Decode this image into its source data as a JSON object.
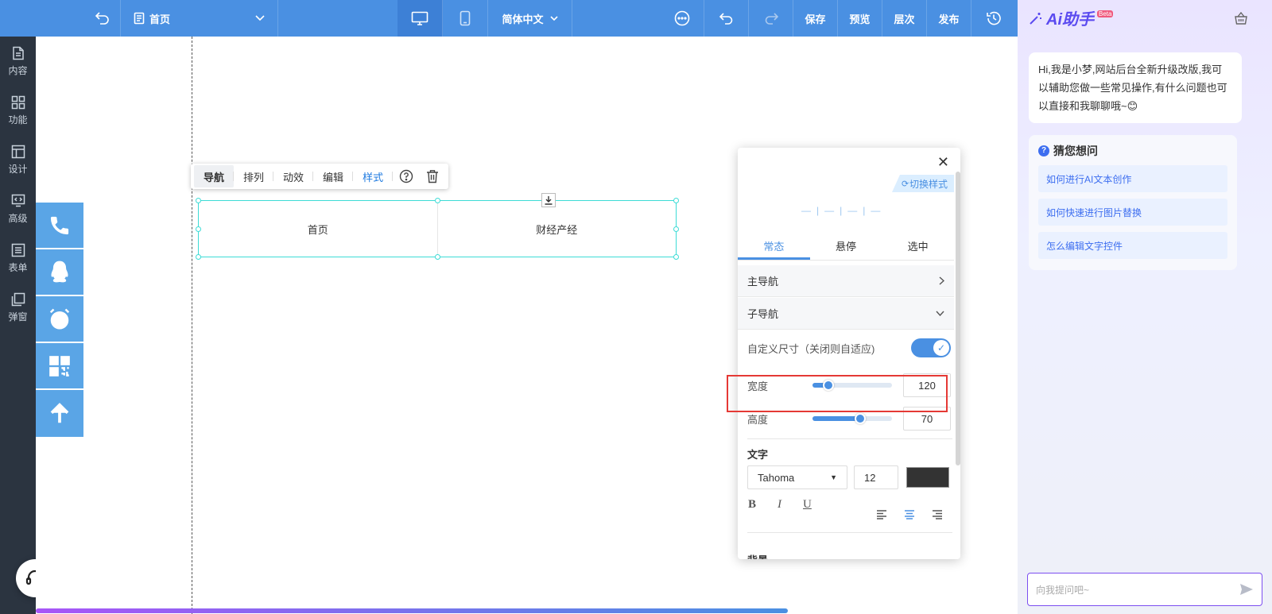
{
  "topbar": {
    "page_name": "首页",
    "language": "简体中文",
    "actions": {
      "save": "保存",
      "preview": "预览",
      "layers": "层次",
      "publish": "发布"
    }
  },
  "sidebar": {
    "items": [
      {
        "label": "内容",
        "icon": "file-icon"
      },
      {
        "label": "功能",
        "icon": "grid-icon"
      },
      {
        "label": "设计",
        "icon": "layout-icon"
      },
      {
        "label": "高级",
        "icon": "code-icon"
      },
      {
        "label": "表单",
        "icon": "list-icon"
      },
      {
        "label": "弹窗",
        "icon": "popup-icon"
      }
    ]
  },
  "floatbar": {
    "icons": [
      "phone-icon",
      "qq-icon",
      "alarm-icon",
      "qrcode-icon",
      "arrow-up-icon"
    ]
  },
  "toolbar": {
    "nav": "导航",
    "arrange": "排列",
    "animate": "动效",
    "edit": "编辑",
    "style": "样式"
  },
  "nav_items": [
    "首页",
    "财经产经"
  ],
  "panel": {
    "switch_style": "切换样式",
    "preview_marks": [
      "—",
      "|",
      "—",
      "|",
      "—",
      "|",
      "—"
    ],
    "tabs": [
      "常态",
      "悬停",
      "选中"
    ],
    "main_nav": "主导航",
    "sub_nav": "子导航",
    "custom_size": "自定义尺寸（关闭则自适应)",
    "custom_size_enabled": true,
    "width_label": "宽度",
    "width_value": "120",
    "width_slider_fraction": 0.2,
    "height_label": "高度",
    "height_value": "70",
    "height_slider_fraction": 0.6,
    "text_section": "文字",
    "font": "Tahoma",
    "font_size": "12",
    "text_color": "#333333",
    "background_section": "背景"
  },
  "ai": {
    "title": "Ai助手",
    "beta": "Beta",
    "greeting": "Hi,我是小梦,网站后台全新升级改版,我可以辅助您做一些常见操作,有什么问题也可以直接和我聊聊哦~😊",
    "guess_title": "猜您想问",
    "questions": [
      "如何进行AI文本创作",
      "如何快速进行图片替换",
      "怎么编辑文字控件"
    ],
    "input_placeholder": "向我提问吧~"
  },
  "colors": {
    "primary": "#4a90e2",
    "sidebar": "#2b3440",
    "floatbar": "#5aa5e6",
    "highlight": "#e53935"
  }
}
